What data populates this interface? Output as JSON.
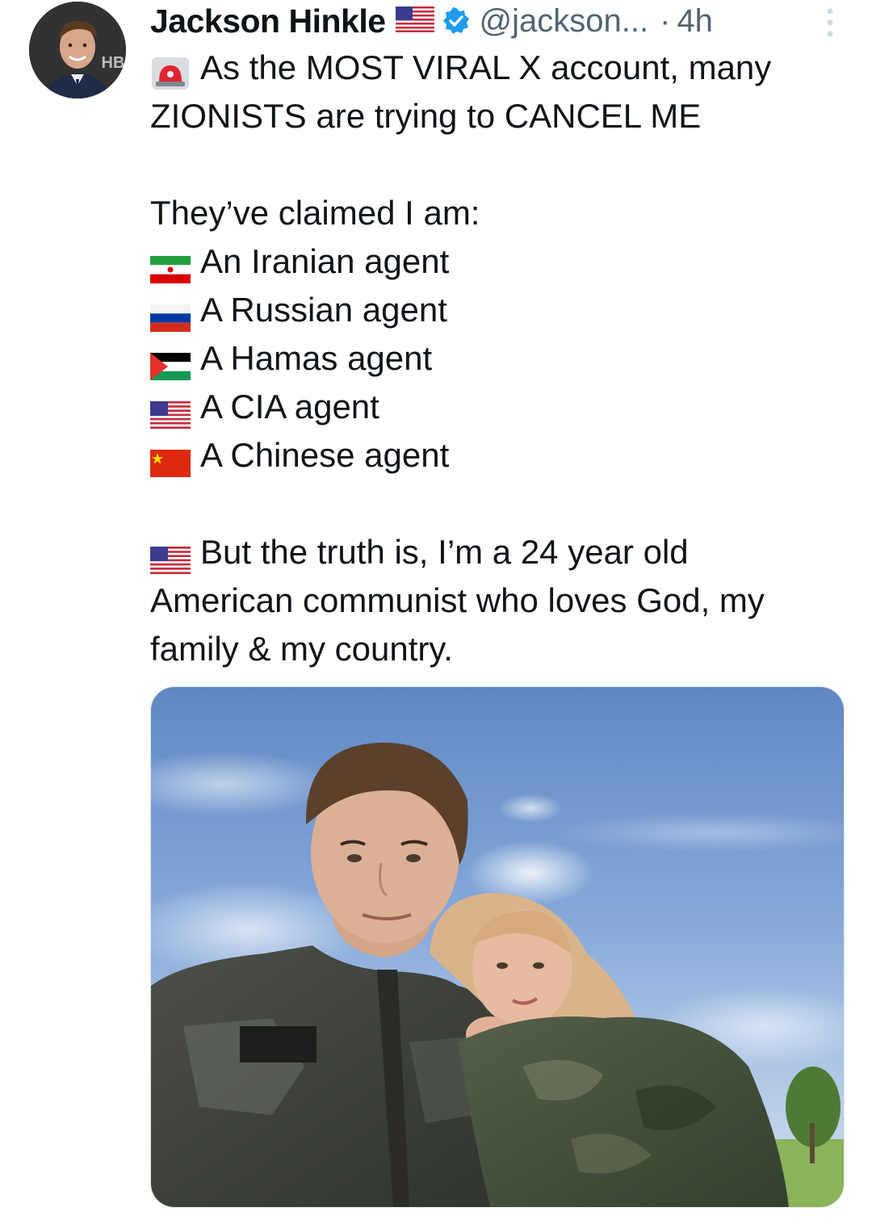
{
  "tweet": {
    "author": {
      "display_name": "Jackson Hinkle",
      "handle": "@jackson...",
      "separator": "·",
      "time": "4h",
      "avatar_badge": "HB",
      "flag_icon": "us-flag-icon",
      "verified_icon": "verified-badge-icon",
      "verified_color": "#1d9bf0"
    },
    "lines": [
      {
        "icon": "rotating-light-icon",
        "text": "As the MOST VIRAL X account, many"
      },
      {
        "icon": "",
        "text": "ZIONISTS are trying to CANCEL ME"
      },
      {
        "icon": "",
        "text": ""
      },
      {
        "icon": "",
        "text": "They’ve claimed I am:"
      },
      {
        "icon": "iran-flag-icon",
        "text": "An Iranian agent"
      },
      {
        "icon": "russia-flag-icon",
        "text": "A Russian agent"
      },
      {
        "icon": "palestine-flag-icon",
        "text": "A Hamas agent"
      },
      {
        "icon": "us-flag-icon",
        "text": "A CIA agent"
      },
      {
        "icon": "china-flag-icon",
        "text": "A Chinese agent"
      },
      {
        "icon": "",
        "text": ""
      },
      {
        "icon": "us-flag-icon",
        "text": "But the truth is, I’m a 24 year old"
      },
      {
        "icon": "",
        "text": "American communist who loves God, my"
      },
      {
        "icon": "",
        "text": "family & my country."
      }
    ],
    "media": {
      "type": "photo",
      "icon": "selfie-photo"
    },
    "colors": {
      "text": "#0f1419",
      "secondary": "#536471",
      "background": "#ffffff"
    }
  }
}
